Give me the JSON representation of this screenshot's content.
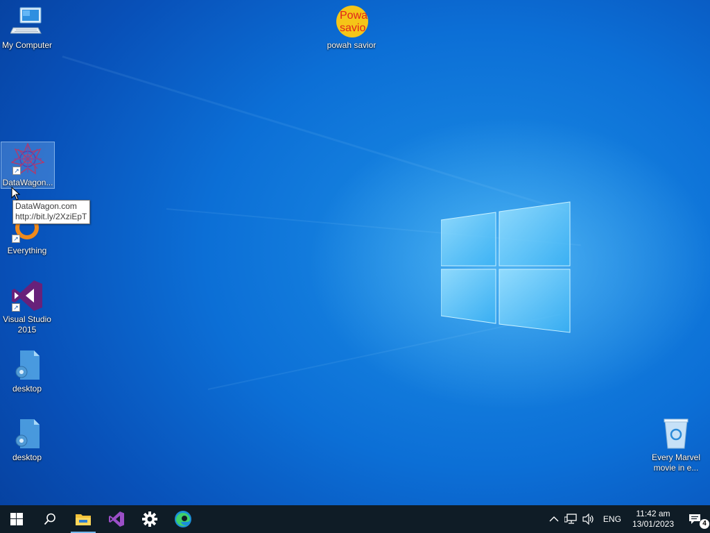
{
  "desktop": {
    "icons": [
      {
        "label": "My Computer"
      },
      {
        "label": "powah savior",
        "badge_line1": "Powa",
        "badge_line2": "savio"
      },
      {
        "label": "DataWagon..."
      },
      {
        "label": "Everything"
      },
      {
        "label": "Visual Studio 2015"
      },
      {
        "label": "desktop"
      },
      {
        "label": "desktop"
      },
      {
        "label": "Every Marvel movie in e..."
      }
    ],
    "tooltip": {
      "line1": "DataWagon.com",
      "line2": "http://bit.ly/2XziEpT"
    }
  },
  "taskbar": {
    "buttons": [
      {
        "icon": "windows-start-icon"
      },
      {
        "icon": "search-icon"
      },
      {
        "icon": "file-explorer-icon"
      },
      {
        "icon": "visual-studio-icon"
      },
      {
        "icon": "settings-gear-icon"
      },
      {
        "icon": "edge-browser-icon"
      }
    ],
    "tray": {
      "language": "ENG",
      "time": "11:42 am",
      "date": "13/01/2023",
      "notification_count": "4"
    }
  },
  "colors": {
    "wallpaper": "#0c6fd6",
    "taskbar": "#0f1c26",
    "accent": "#76b9ed"
  }
}
